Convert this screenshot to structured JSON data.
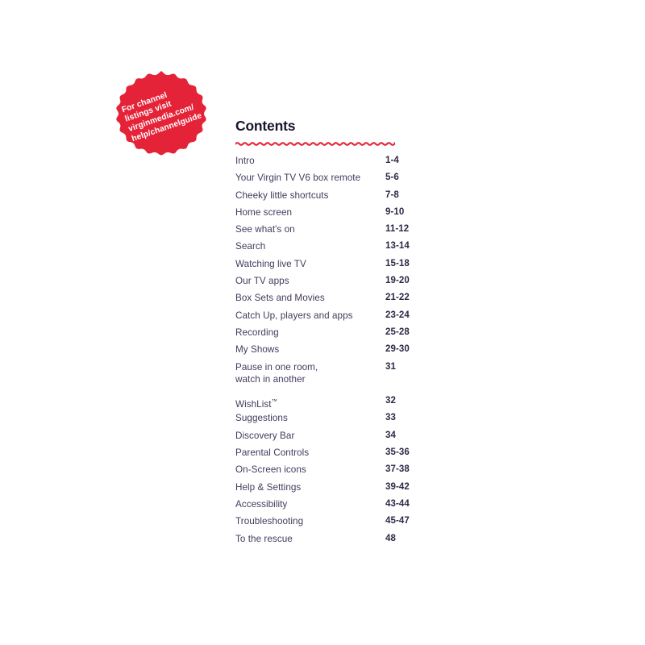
{
  "page": {
    "background_color": "#ffffff",
    "brand_red": "#e52338",
    "title_color": "#19152b",
    "entry_color": "#453a5c",
    "page_number_color": "#2f2745"
  },
  "badge": {
    "shape": "starburst-badge",
    "fill_color": "#e52338",
    "text_color": "#ffffff",
    "rotation_deg": -19,
    "lines": [
      "For channel",
      "listings visit",
      "virginmedia.com/",
      "help/channelguide"
    ]
  },
  "contents": {
    "title": "Contents",
    "divider": "red-wavy-line"
  },
  "toc": {
    "entries": [
      {
        "title": "Intro",
        "title_line2": "",
        "pages": "1-4"
      },
      {
        "title": "Your Virgin TV V6 box remote",
        "title_line2": "",
        "pages": "5-6"
      },
      {
        "title": "Cheeky little shortcuts",
        "title_line2": "",
        "pages": "7-8"
      },
      {
        "title": "Home screen",
        "title_line2": "",
        "pages": "9-10"
      },
      {
        "title": "See what's on",
        "title_line2": "",
        "pages": "11-12"
      },
      {
        "title": "Search",
        "title_line2": "",
        "pages": "13-14"
      },
      {
        "title": "Watching live TV",
        "title_line2": "",
        "pages": "15-18"
      },
      {
        "title": "Our TV apps",
        "title_line2": "",
        "pages": "19-20"
      },
      {
        "title": "Box Sets and Movies",
        "title_line2": "",
        "pages": "21-22"
      },
      {
        "title": "Catch Up, players and apps",
        "title_line2": "",
        "pages": "23-24"
      },
      {
        "title": "Recording",
        "title_line2": "",
        "pages": "25-28"
      },
      {
        "title": "My Shows",
        "title_line2": "",
        "pages": "29-30"
      },
      {
        "title": "Pause in one room,",
        "title_line2": "watch in another",
        "pages": "31"
      },
      {
        "title": "WishList",
        "title_line2": "",
        "trademark": "™",
        "pages": "32"
      },
      {
        "title": "Suggestions",
        "title_line2": "",
        "pages": "33"
      },
      {
        "title": "Discovery Bar",
        "title_line2": "",
        "pages": "34"
      },
      {
        "title": "Parental Controls",
        "title_line2": "",
        "pages": "35-36"
      },
      {
        "title": "On-Screen icons",
        "title_line2": "",
        "pages": "37-38"
      },
      {
        "title": "Help & Settings",
        "title_line2": "",
        "pages": "39-42"
      },
      {
        "title": "Accessibility",
        "title_line2": "",
        "pages": "43-44"
      },
      {
        "title": "Troubleshooting",
        "title_line2": "",
        "pages": "45-47"
      },
      {
        "title": "To the rescue",
        "title_line2": "",
        "pages": "48"
      }
    ]
  }
}
